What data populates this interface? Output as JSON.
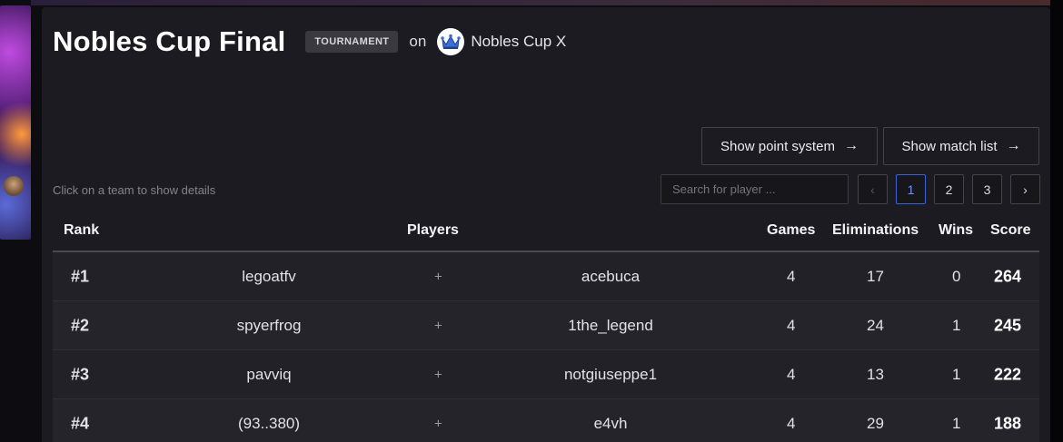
{
  "event": {
    "title": "Nobles Cup Final",
    "badge": "TOURNAMENT",
    "on_text": "on",
    "organizer": "Nobles Cup X"
  },
  "buttons": {
    "point_system": "Show point system",
    "match_list": "Show match list",
    "arrow": "→"
  },
  "hint": "Click on a team to show details",
  "search": {
    "placeholder": "Search for player ..."
  },
  "pagination": {
    "prev": "‹",
    "pages": [
      "1",
      "2",
      "3"
    ],
    "current": "1",
    "next": "›"
  },
  "table": {
    "headers": {
      "rank": "Rank",
      "players": "Players",
      "games": "Games",
      "eliminations": "Eliminations",
      "wins": "Wins",
      "score": "Score"
    },
    "rows": [
      {
        "rank": "#1",
        "player1": "legoatfv",
        "plus": "+",
        "player2": "acebuca",
        "games": "4",
        "eliminations": "17",
        "wins": "0",
        "score": "264"
      },
      {
        "rank": "#2",
        "player1": "spyerfrog",
        "plus": "+",
        "player2": "1the_legend",
        "games": "4",
        "eliminations": "24",
        "wins": "1",
        "score": "245"
      },
      {
        "rank": "#3",
        "player1": "pavviq",
        "plus": "+",
        "player2": "notgiuseppe1",
        "games": "4",
        "eliminations": "13",
        "wins": "1",
        "score": "222"
      },
      {
        "rank": "#4",
        "player1": "(93..380)",
        "plus": "+",
        "player2": "e4vh",
        "games": "4",
        "eliminations": "29",
        "wins": "1",
        "score": "188"
      }
    ]
  },
  "colors": {
    "panel": "#1c1b21",
    "accent_blue": "#3a63d6",
    "badge_bg": "#3a393f"
  }
}
